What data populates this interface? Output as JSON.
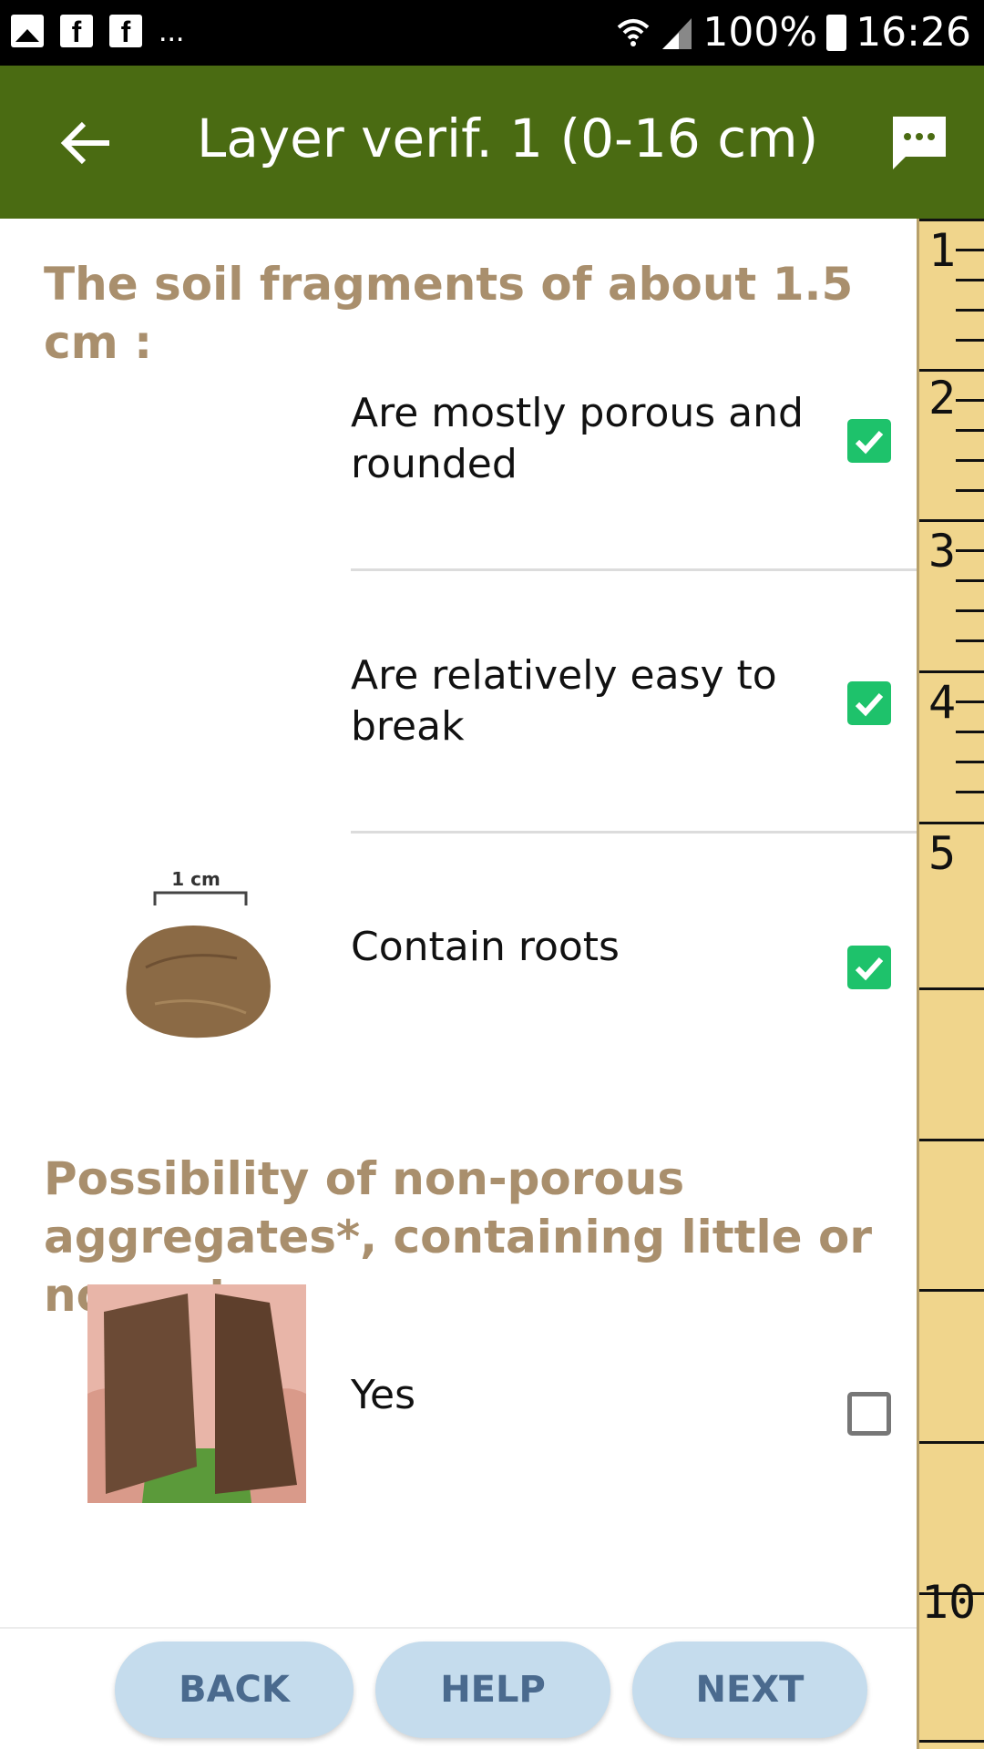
{
  "status_bar": {
    "battery": "100%",
    "time": "16:26",
    "notifications": "..."
  },
  "app_bar": {
    "title": "Layer verif. 1 (0-16 cm)"
  },
  "section1": {
    "title": "The soil fragments of about 1.5 cm :",
    "options": [
      {
        "label": "Are mostly porous and rounded",
        "checked": true
      },
      {
        "label": "Are relatively easy to break",
        "checked": true
      },
      {
        "label": "Contain roots",
        "checked": true
      }
    ],
    "image_scale_label": "1 cm"
  },
  "section2": {
    "title": "Possibility of non-porous aggregates*, containing little or no roots",
    "options": [
      {
        "label": "Yes",
        "checked": false
      }
    ]
  },
  "ruler": {
    "marks": [
      "1",
      "2",
      "3",
      "4",
      "5",
      "10"
    ]
  },
  "buttons": {
    "back": "BACK",
    "help": "HELP",
    "next": "NEXT"
  },
  "colors": {
    "appbar": "#4a6b12",
    "section_title": "#a98f6d",
    "check_on": "#1ec26b",
    "button_bg": "#c5dced",
    "button_text": "#4a6a8e",
    "ruler": "#f0d58c"
  }
}
